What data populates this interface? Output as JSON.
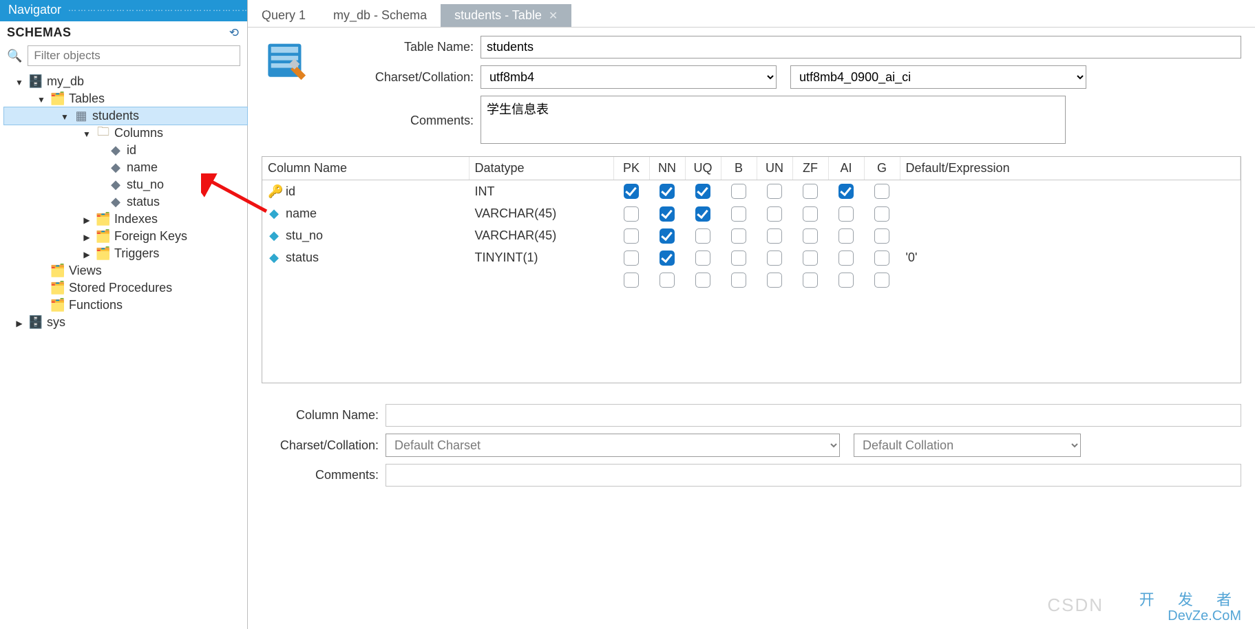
{
  "navigator": {
    "title": "Navigator",
    "schemas_label": "SCHEMAS",
    "filter_placeholder": "Filter objects"
  },
  "tree": {
    "db": "my_db",
    "tables": "Tables",
    "students": "students",
    "columns": "Columns",
    "cols": {
      "id": "id",
      "name": "name",
      "stu_no": "stu_no",
      "status": "status"
    },
    "indexes": "Indexes",
    "foreign_keys": "Foreign Keys",
    "triggers": "Triggers",
    "views": "Views",
    "stored_procs": "Stored Procedures",
    "functions": "Functions",
    "sys": "sys"
  },
  "tabs": {
    "t1": "Query 1",
    "t2": "my_db - Schema",
    "t3": "students - Table"
  },
  "form": {
    "table_name_label": "Table Name:",
    "table_name": "students",
    "charset_label": "Charset/Collation:",
    "charset": "utf8mb4",
    "collation": "utf8mb4_0900_ai_ci",
    "comments_label": "Comments:",
    "comments": "学生信息表"
  },
  "columns_header": {
    "name": "Column Name",
    "type": "Datatype",
    "pk": "PK",
    "nn": "NN",
    "uq": "UQ",
    "b": "B",
    "un": "UN",
    "zf": "ZF",
    "ai": "AI",
    "g": "G",
    "def": "Default/Expression"
  },
  "columns": [
    {
      "name": "id",
      "type": "INT",
      "icon": "key",
      "pk": true,
      "nn": true,
      "uq": true,
      "b": false,
      "un": false,
      "zf": false,
      "ai": true,
      "g": false,
      "def": ""
    },
    {
      "name": "name",
      "type": "VARCHAR(45)",
      "icon": "blue",
      "pk": false,
      "nn": true,
      "uq": true,
      "b": false,
      "un": false,
      "zf": false,
      "ai": false,
      "g": false,
      "def": ""
    },
    {
      "name": "stu_no",
      "type": "VARCHAR(45)",
      "icon": "blue",
      "pk": false,
      "nn": true,
      "uq": false,
      "b": false,
      "un": false,
      "zf": false,
      "ai": false,
      "g": false,
      "def": ""
    },
    {
      "name": "status",
      "type": "TINYINT(1)",
      "icon": "blue",
      "pk": false,
      "nn": true,
      "uq": false,
      "b": false,
      "un": false,
      "zf": false,
      "ai": false,
      "g": false,
      "def": "'0'"
    }
  ],
  "bottom": {
    "column_name_label": "Column Name:",
    "column_name": "",
    "charset_label": "Charset/Collation:",
    "charset": "Default Charset",
    "collation": "Default Collation",
    "comments_label": "Comments:",
    "comments": ""
  },
  "watermark": {
    "csdn": "CSDN",
    "zh": "开 发 者",
    "en": "DevZe.CoM"
  }
}
